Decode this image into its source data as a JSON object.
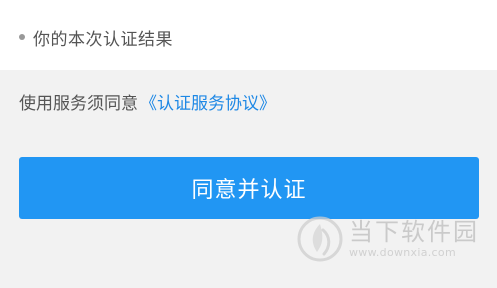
{
  "result_item": {
    "text": "你的本次认证结果"
  },
  "agreement": {
    "prefix": "使用服务须同意",
    "link_text": "《认证服务协议》"
  },
  "agree_button": {
    "label": "同意并认证"
  },
  "watermark": {
    "name": "当下软件园",
    "url": "www.downxia.com"
  },
  "colors": {
    "accent": "#2196f3",
    "link": "#1e88e5",
    "background": "#f2f2f2"
  }
}
